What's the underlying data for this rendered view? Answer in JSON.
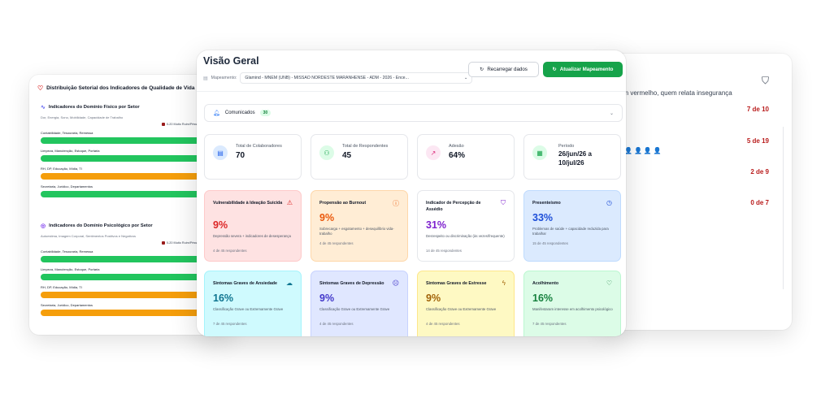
{
  "left_panel": {
    "title": "Distribuição Setorial dos Indicadores de Qualidade de Vida",
    "sections": [
      {
        "title": "Indicadores do Domínio Físico por Setor",
        "subtitle": "Dor, Energia, Sono, Mobilidade, Capacidade de Trabalho",
        "legend": [
          "0-20 Muito Ruim/Péssima",
          "21-40 Ru"
        ],
        "rows": [
          {
            "label": "Contabilidade, Tesouraria, Remessa",
            "status": "green"
          },
          {
            "label": "Limpeza, Manutenção, Estoque, Portaria",
            "status": "green"
          },
          {
            "label": "RH, DP, Educação, Mídia, TI",
            "status": "orange"
          },
          {
            "label": "Secretaria, Jurídico, Departamentos",
            "status": "green"
          }
        ]
      },
      {
        "title": "Indicadores do Domínio Psicológico por Setor",
        "subtitle": "Autoestima, Imagem Corporal, Sentimentos Positivos e Negativos",
        "legend": [
          "0-20 Muito Ruim/Péssima",
          "21-40 Ru"
        ],
        "rows": [
          {
            "label": "Contabilidade, Tesouraria, Remessa",
            "status": "green"
          },
          {
            "label": "Limpeza, Manutenção, Estoque, Portaria",
            "status": "green"
          },
          {
            "label": "RH, DP, Educação, Mídia, TI",
            "status": "orange"
          },
          {
            "label": "Secretaria, Jurídico, Departamentos",
            "status": "orange"
          }
        ]
      }
    ]
  },
  "right_panel": {
    "text": "em vermelho, quem relata insegurança",
    "values": [
      "7 de 10",
      "5 de 19",
      "2 de 9",
      "0 de 7"
    ]
  },
  "main": {
    "title": "Visão Geral",
    "mapping_label": "Mapeamento:",
    "mapping_value": "Glamind - MNEM (UNB) - MISSÃO NORDESTE MARANHENSE - ADM - 2026 - Ence...",
    "reload_label": "Recarregar dados",
    "update_label": "Atualizar Mapeamento",
    "communications_label": "Comunicados",
    "communications_count": "30",
    "stats": [
      {
        "label": "Total de Colaboradores",
        "value": "70"
      },
      {
        "label": "Total de Respondentes",
        "value": "45"
      },
      {
        "label": "Adesão",
        "value": "64%"
      },
      {
        "label": "Período",
        "value": "26/jun/26 a\n10/jul/26"
      }
    ],
    "indicators": [
      {
        "title": "Vulnerabilidade à Ideação Suicida",
        "value": "9%",
        "desc": "Depressão severa + indicadores de desesperança",
        "count": "4 de 45 respondentes",
        "color": "#dc2626"
      },
      {
        "title": "Propensão ao Burnout",
        "value": "9%",
        "desc": "Sobrecarga + esgotamento + desequilíbrio vida-trabalho",
        "count": "4 de 45 respondentes",
        "color": "#ea580c"
      },
      {
        "title": "Indicador de Percepção de Assédio",
        "value": "31%",
        "desc": "Desrespeito ou discriminação (às vezes/frequente)",
        "count": "14 de 45 respondentes",
        "color": "#7e22ce"
      },
      {
        "title": "Presenteísmo",
        "value": "33%",
        "desc": "Problemas de saúde + capacidade reduzida para trabalhar",
        "count": "15 de 45 respondentes",
        "color": "#1d4ed8"
      },
      {
        "title": "Sintomas Graves de Ansiedade",
        "value": "16%",
        "desc": "Classificação Grave ou Extremamente Grave",
        "count": "7 de 45 respondentes",
        "color": "#0e7490"
      },
      {
        "title": "Sintomas Graves de Depressão",
        "value": "9%",
        "desc": "Classificação Grave ou Extremamente Grave",
        "count": "4 de 45 respondentes",
        "color": "#4338ca"
      },
      {
        "title": "Sintomas Graves de Estresse",
        "value": "9%",
        "desc": "Classificação Grave ou Extremamente Grave",
        "count": "4 de 45 respondentes",
        "color": "#a16207"
      },
      {
        "title": "Acolhimento",
        "value": "16%",
        "desc": "Manifestaram interesse em acolhimento psicológico",
        "count": "7 de 45 respondentes",
        "color": "#15803d"
      }
    ]
  }
}
